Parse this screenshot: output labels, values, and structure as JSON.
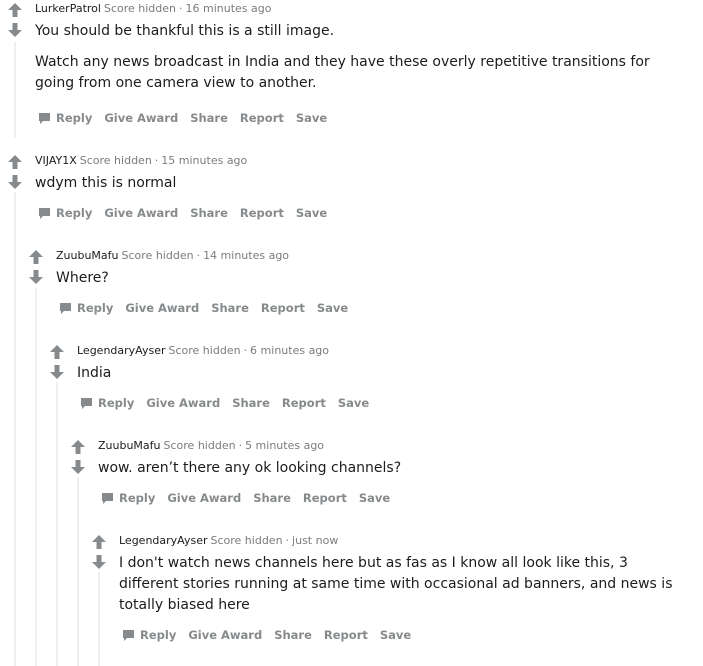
{
  "colors": {
    "text": "#1c1c1c",
    "meta": "#7c7c7c",
    "action": "#878a8c",
    "arrow": "#878a8c",
    "thread_line": "#edeff1"
  },
  "actions": {
    "reply": "Reply",
    "give_award": "Give Award",
    "share": "Share",
    "report": "Report",
    "save": "Save"
  },
  "comments": [
    {
      "author": "LurkerPatrol",
      "score": "Score hidden",
      "separator": "·",
      "time": "16 minutes ago",
      "paragraphs": [
        "You should be thankful this is a still image.",
        "Watch any news broadcast in India and they have these overly repetitive transitions for going from one camera view to another."
      ]
    },
    {
      "author": "VIJAY1X",
      "score": "Score hidden",
      "separator": "·",
      "time": "15 minutes ago",
      "paragraphs": [
        "wdym this is normal"
      ]
    },
    {
      "author": "ZuubuMafu",
      "score": "Score hidden",
      "separator": "·",
      "time": "14 minutes ago",
      "paragraphs": [
        "Where?"
      ]
    },
    {
      "author": "LegendaryAyser",
      "score": "Score hidden",
      "separator": "·",
      "time": "6 minutes ago",
      "paragraphs": [
        "India"
      ]
    },
    {
      "author": "ZuubuMafu",
      "score": "Score hidden",
      "separator": "·",
      "time": "5 minutes ago",
      "paragraphs": [
        "wow. aren’t there any ok looking channels?"
      ]
    },
    {
      "author": "LegendaryAyser",
      "score": "Score hidden",
      "separator": "·",
      "time": "just now",
      "paragraphs": [
        "I don't watch news channels here but as fas as I know all look like this, 3 different stories running at same time with occasional ad banners, and news is totally biased here"
      ]
    }
  ]
}
